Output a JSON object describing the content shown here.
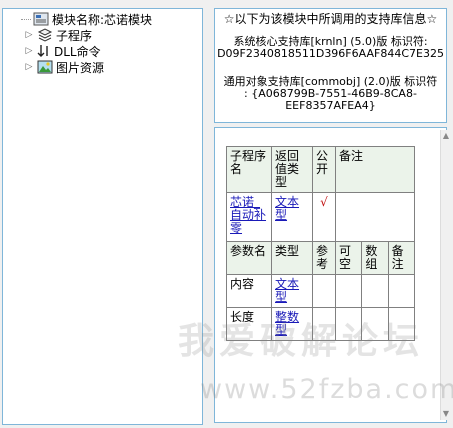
{
  "tree": {
    "items": [
      {
        "label": "模块名称:芯诺模块",
        "icon": "module-icon",
        "expander": ""
      },
      {
        "label": "子程序",
        "icon": "subroutine-icon",
        "expander": "▷"
      },
      {
        "label": "DLL命令",
        "icon": "dll-command-icon",
        "expander": "▷"
      },
      {
        "label": "图片资源",
        "icon": "image-resource-icon",
        "expander": "▷"
      }
    ]
  },
  "info": {
    "title": "☆以下为该模块中所调用的支持库信息☆",
    "core_lib_line": "系统核心支持库[krnln] (5.0)版 标识符:",
    "core_lib_id": "D09F2340818511D396F6AAF844C7E325",
    "obj_lib_line": "通用对象支持库[commobj] (2.0)版 标识符",
    "obj_lib_id": ": {A068799B-7551-46B9-8CA8-",
    "obj_lib_id2": "EEF8357AFEA4}"
  },
  "doc": {
    "table": {
      "h1": [
        "子程序名",
        "返回值类型",
        "公开",
        "备注"
      ],
      "r1": {
        "name": "芯诺_自动补零",
        "ret": "文本型",
        "public": "√",
        "note": ""
      },
      "h2": [
        "参数名",
        "类型",
        "参考",
        "可空",
        "数组",
        "备注"
      ],
      "params": [
        {
          "name": "内容",
          "type": "文本型"
        },
        {
          "name": "长度",
          "type": "整数型"
        }
      ]
    }
  },
  "watermark": {
    "line1": "我爱破解论坛",
    "line2": "www.52fzba.com"
  }
}
